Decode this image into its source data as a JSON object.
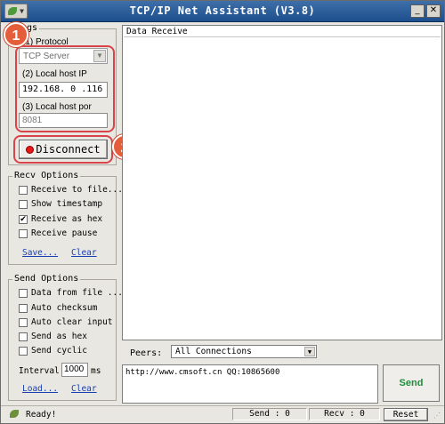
{
  "window": {
    "title": "TCP/IP Net Assistant (V3.8)"
  },
  "settings": {
    "title": "ings",
    "protocol_label": "(1) Protocol",
    "protocol_value": "TCP Server",
    "ip_label": "(2) Local host IP",
    "ip_value": "192.168. 0 .116",
    "port_label": "(3) Local host por",
    "port_value": "8081",
    "disconnect_label": "Disconnect"
  },
  "badges": [
    "1",
    "2"
  ],
  "recv_options": {
    "title": "Recv Options",
    "items": [
      {
        "label": "Receive to file...",
        "checked": false
      },
      {
        "label": "Show timestamp",
        "checked": false
      },
      {
        "label": "Receive as hex",
        "checked": true
      },
      {
        "label": "Receive pause",
        "checked": false
      }
    ],
    "save_link": "Save...",
    "clear_link": "Clear"
  },
  "send_options": {
    "title": "Send Options",
    "items": [
      {
        "label": "Data from file ...",
        "checked": false
      },
      {
        "label": "Auto checksum",
        "checked": false
      },
      {
        "label": "Auto clear input",
        "checked": false
      },
      {
        "label": "Send as hex",
        "checked": false
      },
      {
        "label": "Send cyclic",
        "checked": false
      }
    ],
    "interval_label": "Interval",
    "interval_value": "1000",
    "interval_unit": "ms",
    "load_link": "Load...",
    "clear_link": "Clear"
  },
  "receive": {
    "title": "Data Receive"
  },
  "peers": {
    "label": "Peers:",
    "value": "All Connections"
  },
  "send": {
    "text": "http://www.cmsoft.cn QQ:10865600",
    "button": "Send"
  },
  "status": {
    "ready": "Ready!",
    "send_count": "Send : 0",
    "recv_count": "Recv : 0",
    "reset": "Reset"
  },
  "colors": {
    "accent_red": "#d9434a",
    "badge": "#e55e3c",
    "send_green": "#1f8d3a"
  }
}
